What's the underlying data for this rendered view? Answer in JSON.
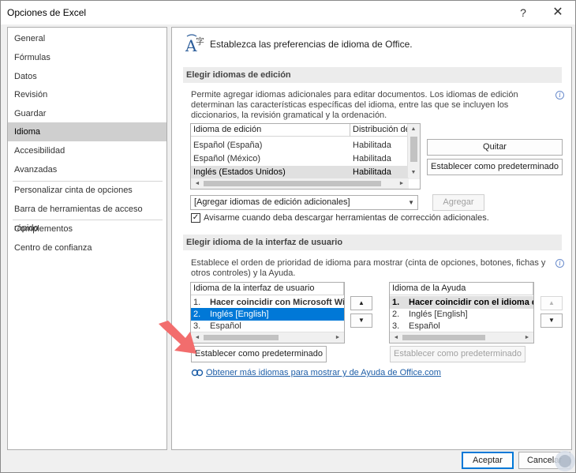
{
  "window": {
    "title": "Opciones de Excel",
    "help_glyph": "?",
    "close_glyph": "✕"
  },
  "sidebar": {
    "items": [
      {
        "label": "General"
      },
      {
        "label": "Fórmulas"
      },
      {
        "label": "Datos"
      },
      {
        "label": "Revisión"
      },
      {
        "label": "Guardar"
      },
      {
        "label": "Idioma",
        "selected": true
      },
      {
        "label": "Accesibilidad"
      },
      {
        "label": "Avanzadas"
      },
      {
        "label": "Personalizar cinta de opciones"
      },
      {
        "label": "Barra de herramientas de acceso rápido"
      },
      {
        "label": "Complementos"
      },
      {
        "label": "Centro de confianza"
      }
    ]
  },
  "header": {
    "text": "Establezca las preferencias de idioma de Office.",
    "icon": "language-icon",
    "icon_glyph_a": "A",
    "icon_glyph_zi": "字"
  },
  "editing": {
    "section_title": "Elegir idiomas de edición",
    "description": "Permite agregar idiomas adicionales para editar documentos. Los idiomas de edición determinan las características específicas del idioma, entre las que se incluyen los diccionarios, la revisión gramatical y la ordenación.",
    "info_glyph": "i",
    "columns": [
      "Idioma de edición",
      "Distribución de"
    ],
    "rows": [
      {
        "language": "Español (España)",
        "status": "Habilitada"
      },
      {
        "language": "Español (México)",
        "status": "Habilitada"
      },
      {
        "language": "Inglés (Estados Unidos)",
        "status": "Habilitada",
        "selected": true
      }
    ],
    "remove_button": "Quitar",
    "set_default_button": "Establecer como predeterminado",
    "add_combo_value": "[Agregar idiomas de edición adicionales]",
    "add_button": "Agregar",
    "notify_checkbox_label": "Avisarme cuando deba descargar herramientas de corrección adicionales.",
    "notify_checked": true,
    "check_glyph": "✓"
  },
  "ui_language": {
    "section_title": "Elegir idioma de la interfaz de usuario",
    "description": "Establece el orden de prioridad de idioma para mostrar (cinta de opciones, botones, fichas y otros controles) y la Ayuda.",
    "info_glyph": "i",
    "display_list": {
      "header": "Idioma de la interfaz de usuario",
      "rows": [
        {
          "num": "1.",
          "label": "Hacer coincidir con Microsoft Windows",
          "bold": true
        },
        {
          "num": "2.",
          "label": "Inglés [English]",
          "highlighted": true
        },
        {
          "num": "3.",
          "label": "Español"
        }
      ]
    },
    "help_list": {
      "header": "Idioma de la Ayuda",
      "rows": [
        {
          "num": "1.",
          "label": "Hacer coincidir con el idioma de presentación",
          "bold": true,
          "selected": true
        },
        {
          "num": "2.",
          "label": "Inglés [English]"
        },
        {
          "num": "3.",
          "label": "Español"
        }
      ]
    },
    "move_up_glyph": "▲",
    "move_down_glyph": "▼",
    "set_default_display_button": "Establecer como predeterminado",
    "set_default_help_button": "Establecer como predeterminado",
    "more_languages_link": "Obtener más idiomas para mostrar y de Ayuda de Office.com"
  },
  "footer": {
    "ok_button": "Aceptar",
    "cancel_button": "Cancelar"
  },
  "scroll_glyphs": {
    "up": "▲",
    "down": "▼",
    "left": "◄",
    "right": "►",
    "combo": "▼"
  },
  "colors": {
    "accent": "#0078d7",
    "selection": "#cfcfcf",
    "link": "#1f5fa8",
    "pointer": "#f26d6d"
  }
}
